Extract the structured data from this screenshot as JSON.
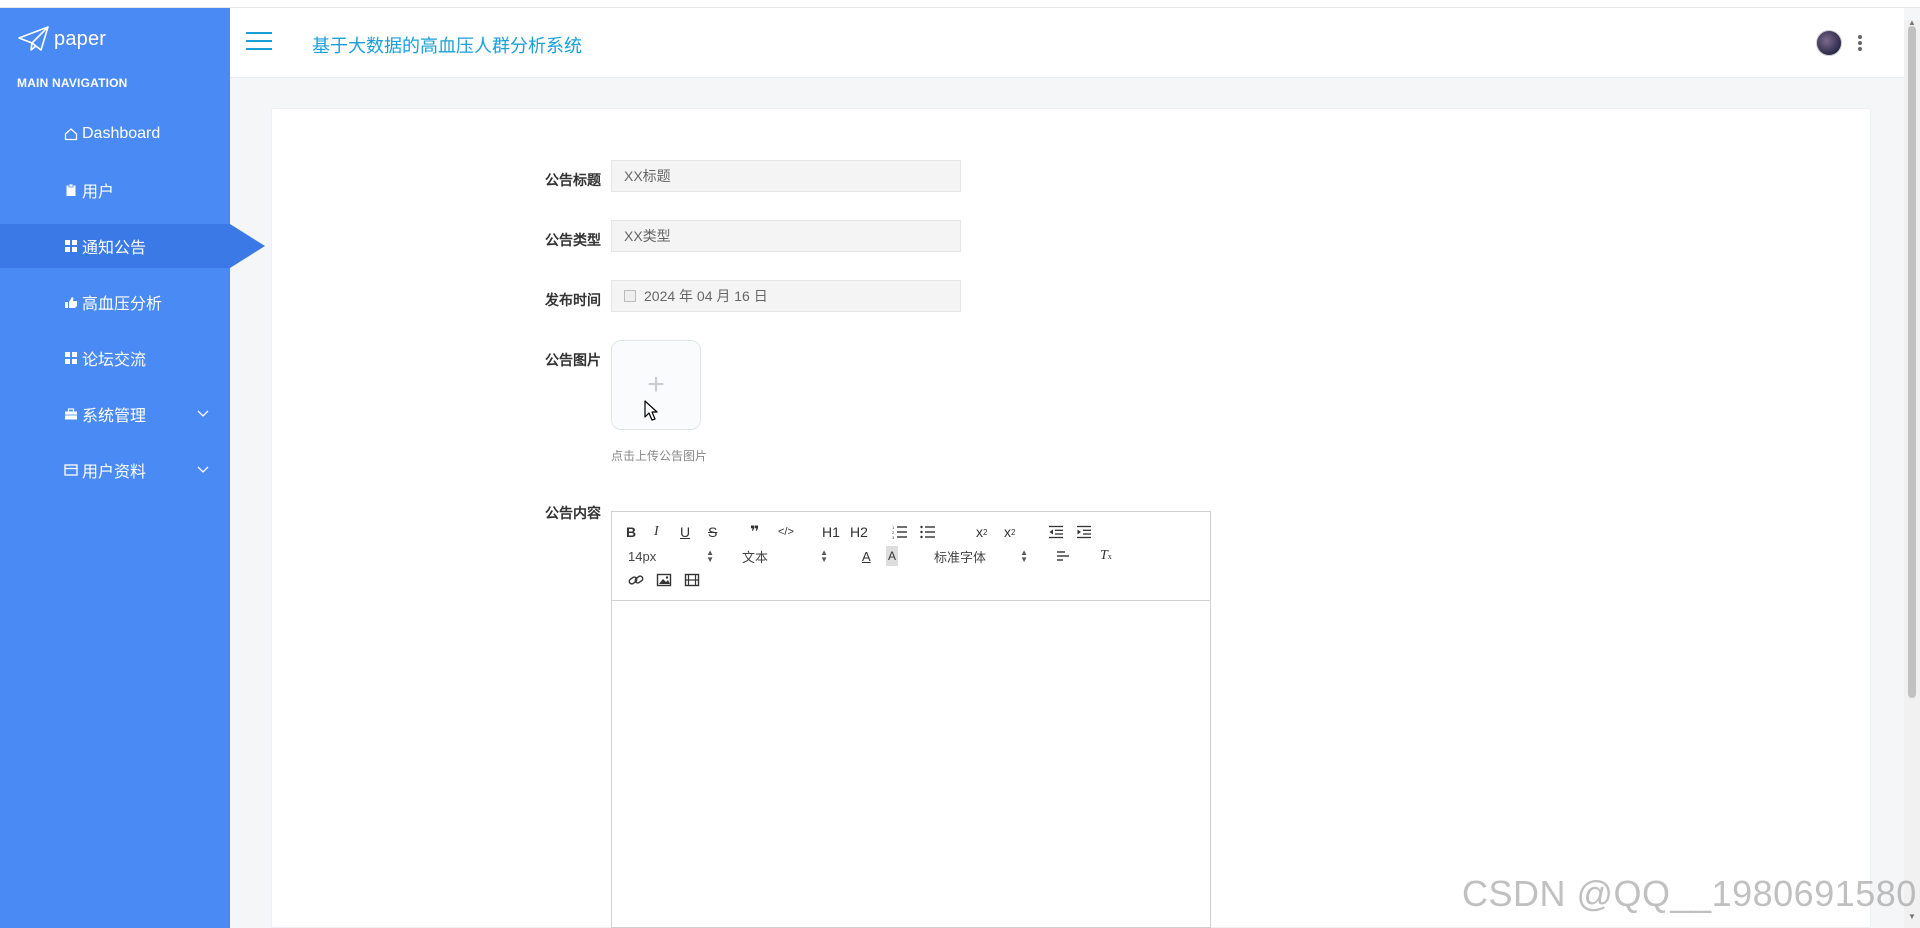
{
  "app": {
    "logo_text": "paper",
    "system_title": "基于大数据的高血压人群分析系统"
  },
  "sidebar": {
    "section_title": "MAIN NAVIGATION",
    "items": [
      {
        "label": "Dashboard",
        "icon": "home-icon"
      },
      {
        "label": "用户",
        "icon": "clipboard-icon"
      },
      {
        "label": "通知公告",
        "icon": "grid-icon",
        "active": true
      },
      {
        "label": "高血压分析",
        "icon": "hand-icon"
      },
      {
        "label": "论坛交流",
        "icon": "grid-icon"
      },
      {
        "label": "系统管理",
        "icon": "briefcase-icon",
        "expandable": true
      },
      {
        "label": "用户资料",
        "icon": "card-icon",
        "expandable": true
      }
    ]
  },
  "form": {
    "title_label": "公告标题",
    "title_value": "XX标题",
    "type_label": "公告类型",
    "type_value": "XX类型",
    "date_label": "发布时间",
    "date_value": "2024 年 04 月 16 日",
    "image_label": "公告图片",
    "upload_hint": "点击上传公告图片",
    "content_label": "公告内容"
  },
  "editor": {
    "font_size": "14px",
    "heading_select": "文本",
    "font_family": "标准字体",
    "h1": "H1",
    "h2": "H2"
  },
  "watermark": "CSDN @QQ__1980691580",
  "colors": {
    "sidebar_bg": "#4a8af4",
    "sidebar_active": "#3b7ae6",
    "title_color": "#1aa0d8"
  }
}
